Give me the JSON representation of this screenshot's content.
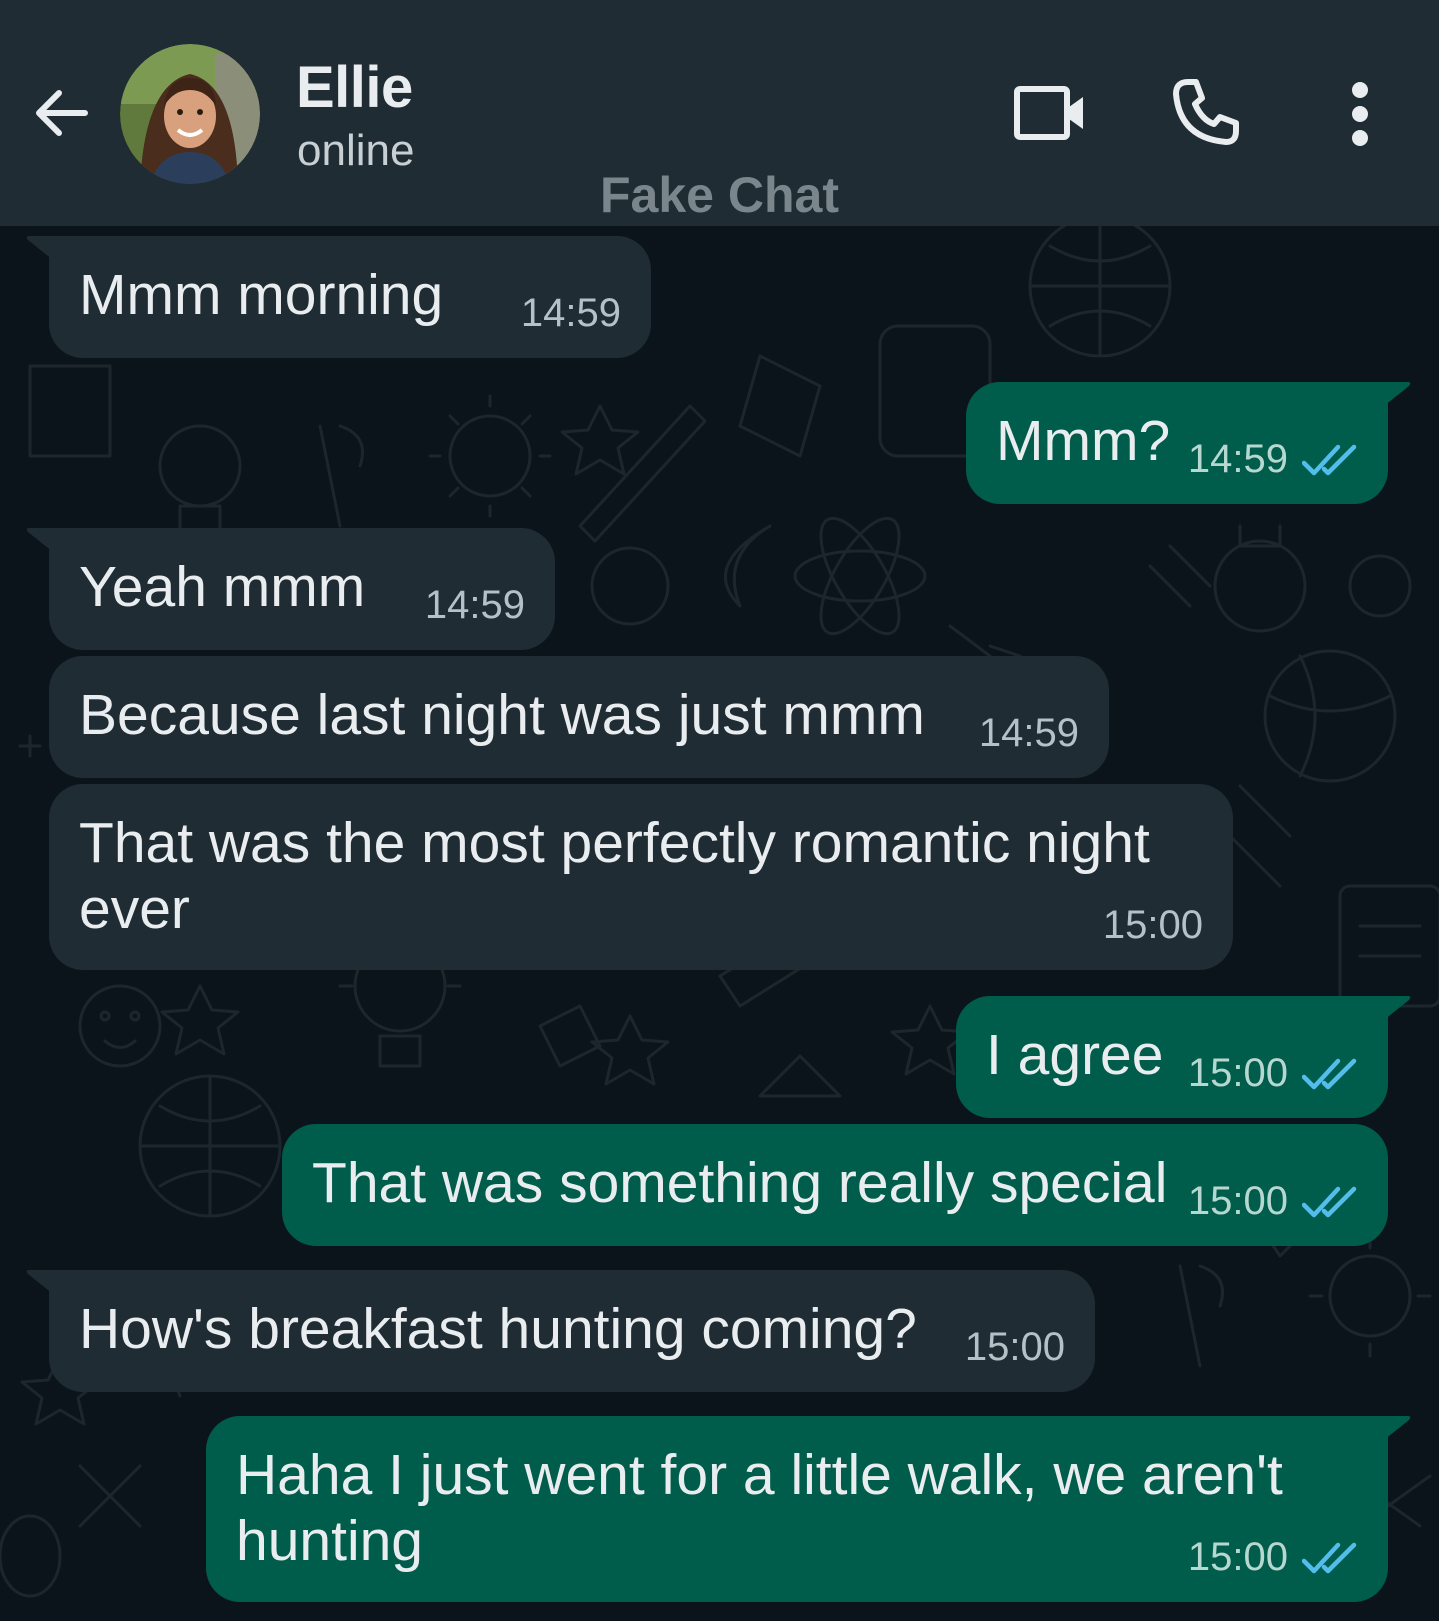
{
  "header": {
    "contact_name": "Ellie",
    "status": "online",
    "watermark": "Fake Chat",
    "icons": [
      "back-arrow-icon",
      "video-call-icon",
      "phone-icon",
      "more-vert-icon"
    ]
  },
  "colors": {
    "header_bg": "#1f2c34",
    "chat_bg": "#0b141a",
    "incoming_bubble": "#1f2c34",
    "outgoing_bubble": "#005c4b",
    "read_ticks": "#53bdeb"
  },
  "messages": [
    {
      "direction": "incoming",
      "text": "Mmm morning",
      "time": "14:59"
    },
    {
      "direction": "outgoing",
      "text": "Mmm?",
      "time": "14:59",
      "status": "read"
    },
    {
      "direction": "incoming",
      "text": "Yeah mmm",
      "time": "14:59"
    },
    {
      "direction": "incoming",
      "text": "Because last night was just mmm",
      "time": "14:59"
    },
    {
      "direction": "incoming",
      "text": "That was the most perfectly romantic night ever",
      "time": "15:00"
    },
    {
      "direction": "outgoing",
      "text": "I agree",
      "time": "15:00",
      "status": "read"
    },
    {
      "direction": "outgoing",
      "text": "That was something really special",
      "time": "15:00",
      "status": "read"
    },
    {
      "direction": "incoming",
      "text": "How's breakfast hunting coming?",
      "time": "15:00"
    },
    {
      "direction": "outgoing",
      "text": "Haha I just went for a little walk, we aren't hunting",
      "time": "15:00",
      "status": "read"
    }
  ]
}
